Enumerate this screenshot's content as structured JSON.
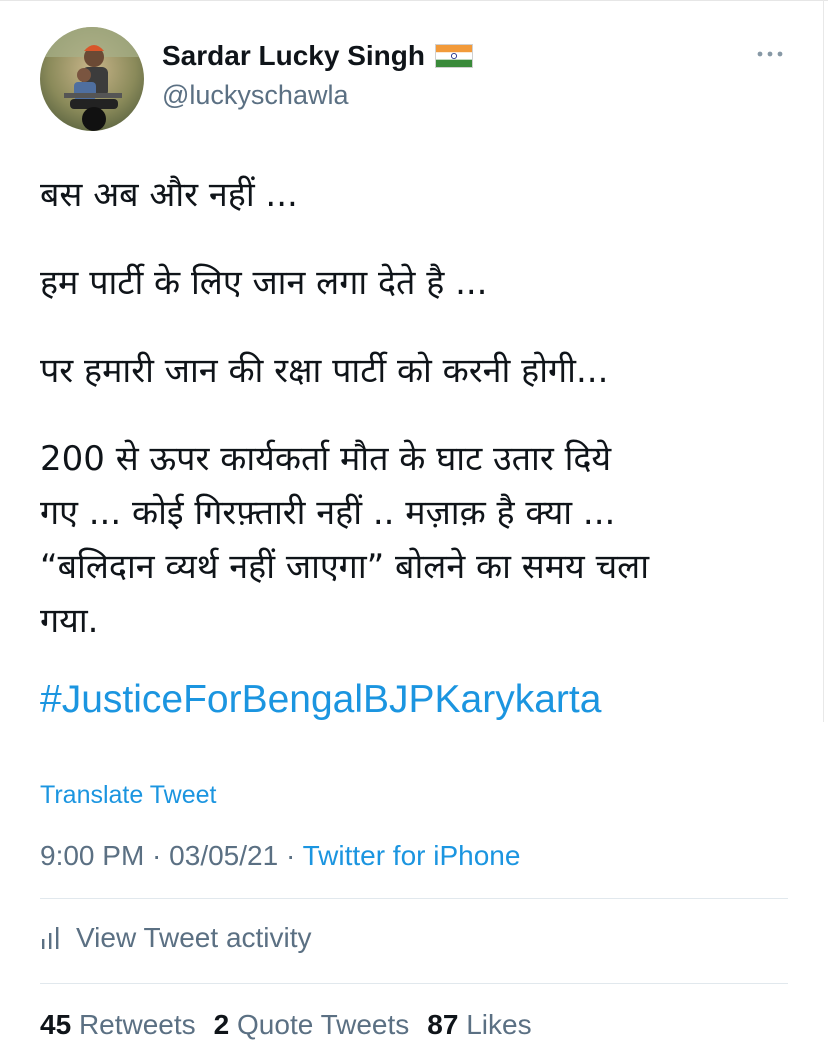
{
  "author": {
    "name": "Sardar Lucky Singh",
    "handle": "@luckyschawla",
    "flag_icon": "india-flag-emoji"
  },
  "tweet": {
    "lines_group1": [
      "बस अब और नहीं ..."
    ],
    "lines_group2": [
      "हम पार्टी के लिए जान लगा देते है ..."
    ],
    "lines_group3": [
      "पर हमारी जान की रक्षा पार्टी को करनी होगी..."
    ],
    "lines_group4": [
      "200 से ऊपर कार्यकर्ता मौत के घाट उतार दिये",
      "गए ... कोई गिरफ़्तारी नहीं .. मज़ाक़ है क्या ...",
      "“बलिदान व्यर्थ नहीं जाएगा” बोलने का समय चला",
      "गया."
    ],
    "hashtag": "#JusticeForBengalBJPKarykarta"
  },
  "translate_label": "Translate Tweet",
  "meta": {
    "time": "9:00 PM",
    "sep": " · ",
    "date": "03/05/21",
    "source": "Twitter for iPhone"
  },
  "activity": {
    "label": "View Tweet activity",
    "icon": "bar-chart-icon"
  },
  "stats": {
    "retweets_count": "45",
    "retweets_label": "Retweets",
    "quotes_count": "2",
    "quotes_label": "Quote Tweets",
    "likes_count": "87",
    "likes_label": "Likes"
  },
  "colors": {
    "link": "#1b95e0",
    "secondary": "#5b7083",
    "primary": "#0f1419",
    "divider": "#e1e8ed"
  }
}
